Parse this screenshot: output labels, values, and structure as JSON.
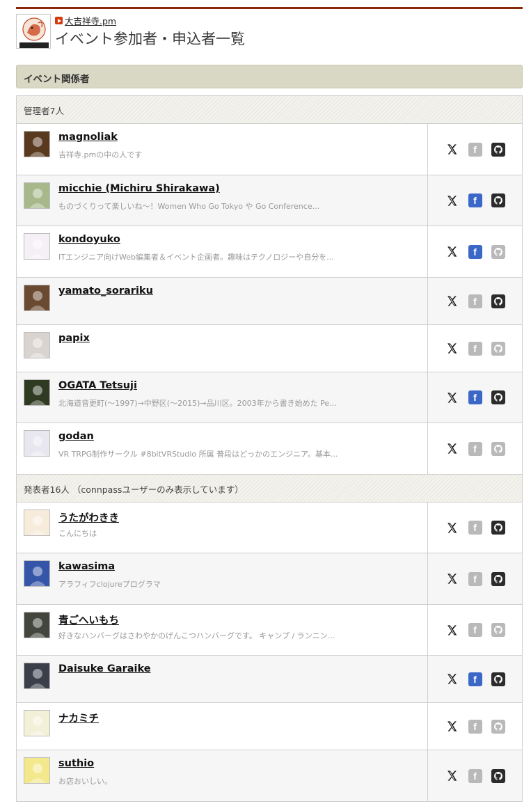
{
  "header": {
    "group_name": "大吉祥寺.pm",
    "page_title": "イベント参加者・申込者一覧",
    "logo_text": "Kichijoji.pm"
  },
  "section": {
    "title": "イベント関係者"
  },
  "groups": [
    {
      "label": "管理者7人",
      "members": [
        {
          "name": "magnoliak",
          "desc": "吉祥寺.pmの中の人です",
          "facebook": false,
          "github": true,
          "avatar_color": "#5a3a1f"
        },
        {
          "name": "micchie (Michiru Shirakawa)",
          "desc": "ものづくりって楽しいね〜！Women Who Go Tokyo や Go Conference...",
          "facebook": true,
          "github": true,
          "avatar_color": "#a7b88a"
        },
        {
          "name": "kondoyuko",
          "desc": "ITエンジニア向けWeb編集者＆イベント企画者。趣味はテクノロジーや自分を...",
          "facebook": true,
          "github": false,
          "avatar_color": "#f4f0f6"
        },
        {
          "name": "yamato_sorariku",
          "desc": "",
          "facebook": false,
          "github": true,
          "avatar_color": "#6b4a32"
        },
        {
          "name": "papix",
          "desc": "",
          "facebook": false,
          "github": false,
          "avatar_color": "#d9d4cf"
        },
        {
          "name": "OGATA Tetsuji",
          "desc": "北海道音更町(〜1997)→中野区(〜2015)→品川区。2003年から書き始めた Pe...",
          "facebook": true,
          "github": true,
          "avatar_color": "#2f3a22"
        },
        {
          "name": "godan",
          "desc": "VR TRPG制作サークル #8bitVRStudio 所属 普段はどっかのエンジニア。基本...",
          "facebook": false,
          "github": false,
          "avatar_color": "#e8e6ee"
        }
      ]
    },
    {
      "label": "発表者16人 （connpassユーザーのみ表示しています）",
      "members": [
        {
          "name": "うたがわきき",
          "desc": "こんにちは",
          "facebook": false,
          "github": true,
          "avatar_color": "#f7ecdc"
        },
        {
          "name": "kawasima",
          "desc": "アラフィフclojureプログラマ",
          "facebook": false,
          "github": true,
          "avatar_color": "#3556a8"
        },
        {
          "name": "青ごへいもち",
          "desc": "好きなハンバーグはさわやかのげんこつハンバーグです。 キャンプ / ランニン...",
          "facebook": false,
          "github": false,
          "avatar_color": "#43463d"
        },
        {
          "name": "Daisuke Garaike",
          "desc": "",
          "facebook": true,
          "github": true,
          "avatar_color": "#3a3f4a"
        },
        {
          "name": "ナカミチ",
          "desc": "",
          "facebook": false,
          "github": false,
          "avatar_color": "#f3f0d8"
        },
        {
          "name": "suthio",
          "desc": "お店おいしい。",
          "facebook": false,
          "github": true,
          "avatar_color": "#f3e98c"
        }
      ]
    }
  ],
  "icons": {
    "twitter": "x-icon",
    "facebook": "facebook-icon",
    "github": "github-icon"
  },
  "colors": {
    "accent_line": "#8a2a0c",
    "facebook_active": "#3b67c7",
    "github_active": "#2b2b2b",
    "inactive": "#b9b9b9"
  }
}
